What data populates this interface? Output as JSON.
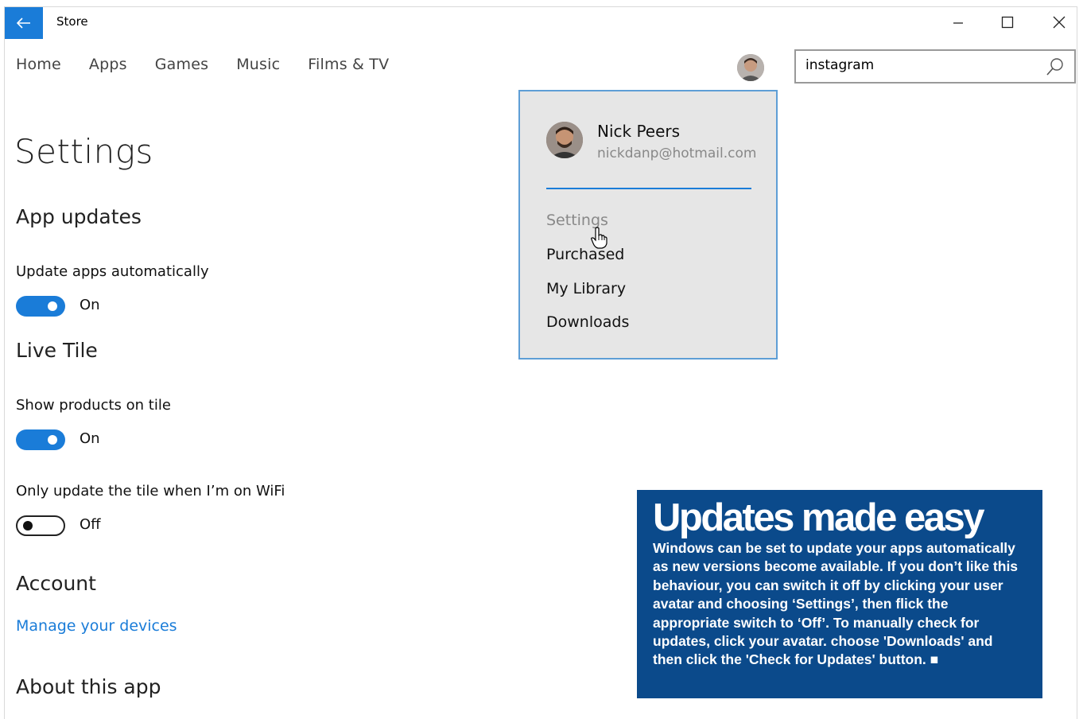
{
  "window": {
    "title": "Store",
    "controls": {
      "minimize": "minimize-icon",
      "maximize": "maximize-icon",
      "close": "close-icon"
    }
  },
  "nav": {
    "items": [
      "Home",
      "Apps",
      "Games",
      "Music",
      "Films & TV"
    ]
  },
  "search": {
    "value": "instagram",
    "icon": "search-icon"
  },
  "settings": {
    "title": "Settings",
    "app_updates": {
      "heading": "App updates",
      "label": "Update apps automatically",
      "state": "On"
    },
    "live_tile": {
      "heading": "Live Tile",
      "show_products_label": "Show products on tile",
      "show_products_state": "On",
      "wifi_label": "Only update the tile when I’m on WiFi",
      "wifi_state": "Off"
    },
    "account": {
      "heading": "Account",
      "link": "Manage your devices"
    },
    "about": {
      "heading": "About this app"
    }
  },
  "account_menu": {
    "name": "Nick Peers",
    "email": "nickdanp@hotmail.com",
    "items": [
      "Settings",
      "Purchased",
      "My Library",
      "Downloads"
    ]
  },
  "infobox": {
    "title": "Updates made easy",
    "body": "Windows can be set to update your apps automatically as new versions become available. If you don’t like this behaviour, you can switch it off by clicking your user avatar and choosing ‘Settings’, then flick the appropriate switch to ‘Off’. To manually check for updates, click your avatar. choose 'Downloads' and then click the 'Check for Updates' button. ■"
  },
  "colors": {
    "accent": "#1a7cd8",
    "infobox_bg": "#0b4a8b",
    "flyout_bg": "#e6e6e6"
  }
}
